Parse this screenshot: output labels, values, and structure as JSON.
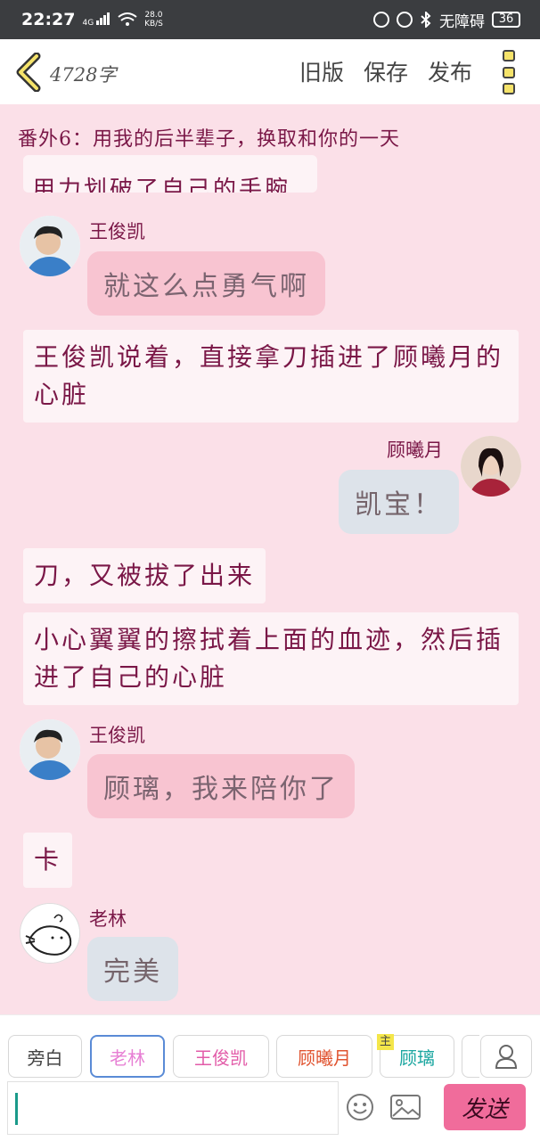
{
  "status_bar": {
    "time": "22:27",
    "network": "4G",
    "speed_value": "28.0",
    "speed_unit": "KB/S",
    "accessibility_label": "无障碍",
    "battery": "36"
  },
  "toolbar": {
    "word_count": "4728字",
    "old_version": "旧版",
    "save": "保存",
    "publish": "发布"
  },
  "chapter": {
    "title": "番外6：用我的后半辈子，换取和你的一天"
  },
  "messages": {
    "clipped_text": "用力划破了自己的手腕",
    "m1_sender": "王俊凯",
    "m1_text": "就这么点勇气啊",
    "n1_text": "王俊凯说着，直接拿刀插进了顾曦月的心脏",
    "m2_sender": "顾曦月",
    "m2_text": "凯宝！",
    "n2_text": "刀，又被拔了出来",
    "n3_text": "小心翼翼的擦拭着上面的血迹，然后插进了自己的心脏",
    "m3_sender": "王俊凯",
    "m3_text": "顾璃，我来陪你了",
    "n4_text": "卡",
    "m4_sender": "老林",
    "m4_text": "完美"
  },
  "characters": {
    "narrator": "旁白",
    "c1": "老林",
    "c2": "王俊凯",
    "c3": "顾曦月",
    "c4": "顾璃",
    "protagonist_tag": "主"
  },
  "colors": {
    "c1": "#e77fd4",
    "c2": "#e25ba8",
    "c3": "#e0532f",
    "c4": "#1aa6a0"
  },
  "input": {
    "send": "发送"
  }
}
